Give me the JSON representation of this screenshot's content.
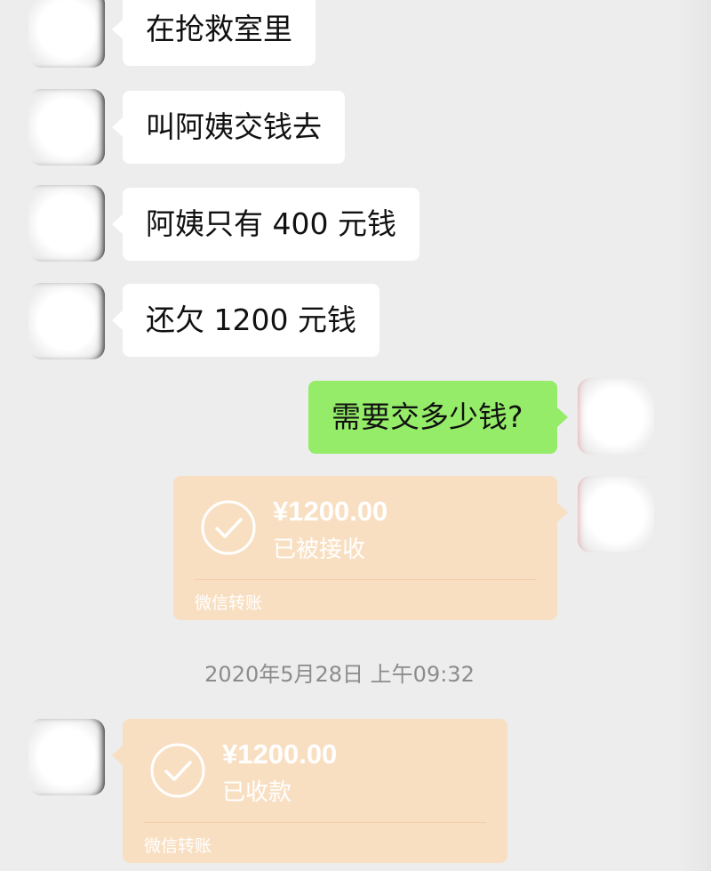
{
  "messages": [
    {
      "text": "在抢救室里"
    },
    {
      "text": "叫阿姨交钱去"
    },
    {
      "text": "阿姨只有 400 元钱"
    },
    {
      "text": "还欠 1200 元钱"
    },
    {
      "text": "需要交多少钱?"
    }
  ],
  "transfer_sent": {
    "amount": "¥1200.00",
    "status": "已被接收",
    "service": "微信转账",
    "icon": "check-circle-icon"
  },
  "timestamp": "2020年5月28日 上午09:32",
  "transfer_received": {
    "amount": "¥1200.00",
    "status": "已收款",
    "service": "微信转账",
    "icon": "check-circle-icon"
  },
  "colors": {
    "background": "#ededed",
    "incoming_bubble": "#ffffff",
    "outgoing_bubble": "#95ec69",
    "transfer_card": "#f9dfc2"
  }
}
